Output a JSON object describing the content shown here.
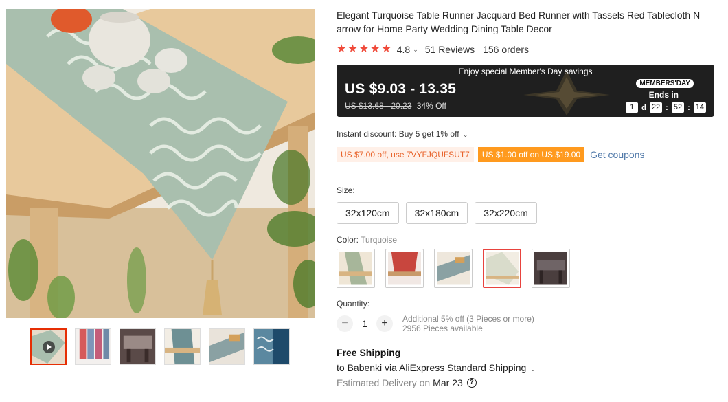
{
  "product": {
    "title_line1": "Elegant Turquoise Table Runner Jacquard Bed Runner with Tassels Red Tablecloth N",
    "title_line2": "arrow for Home Party Wedding Dining Table Decor",
    "rating": "4.8",
    "stars": 5,
    "reviews": "51 Reviews",
    "orders": "156 orders"
  },
  "banner": {
    "headline": "Enjoy special Member's Day savings",
    "price": "US $9.03 - 13.35",
    "old_price": "US $13.68 - 20.23",
    "discount": "34% Off",
    "badge": "MEMBERS'DAY",
    "ends_label": "Ends in",
    "countdown": {
      "days": "1",
      "day_unit": "d",
      "hours": "22",
      "minutes": "52",
      "seconds": "14"
    }
  },
  "instant_discount": "Instant discount: Buy 5 get 1% off",
  "coupons": {
    "code_offer": "US $7.00 off, use 7VYFJQUFSUT7",
    "store_offer": "US $1.00 off on US $19.00",
    "get_label": "Get coupons"
  },
  "size": {
    "label": "Size:",
    "options": [
      "32x120cm",
      "32x180cm",
      "32x220cm"
    ]
  },
  "color": {
    "label": "Color:",
    "selected": "Turquoise",
    "swatch_colors": [
      "#a7b69a",
      "#c8463e",
      "#8aa1a3",
      "#d9dccb",
      "#6f6466"
    ],
    "selected_index": 3
  },
  "quantity": {
    "label": "Quantity:",
    "value": "1",
    "minus": "−",
    "plus": "+",
    "note1": "Additional 5% off (3 Pieces or more)",
    "note2": "2956 Pieces available"
  },
  "shipping": {
    "title": "Free Shipping",
    "line": "to Babenki via AliExpress Standard Shipping",
    "delivery_label": "Estimated Delivery on",
    "delivery_date": "Mar 23",
    "help": "?"
  },
  "colors": {
    "accent_red": "#e62e04",
    "banner_bg": "#1f1f1f",
    "coupon_orange": "#ff9a1e",
    "link_blue": "#5079a9"
  }
}
